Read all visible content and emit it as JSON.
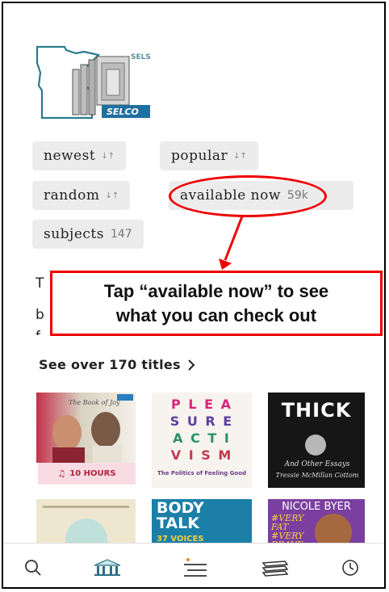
{
  "logo": {
    "top_text": "SELS",
    "bottom_text": "SELCO"
  },
  "filters": [
    {
      "label": "newest",
      "sort": "↓↑",
      "count": ""
    },
    {
      "label": "popular",
      "sort": "↓↑",
      "count": ""
    },
    {
      "label": "random",
      "sort": "↓↑",
      "count": ""
    },
    {
      "label": "available now",
      "sort": "",
      "count": "59k"
    },
    {
      "label": "subjects",
      "sort": "",
      "count": "147"
    }
  ],
  "callout": {
    "line1": "Tap “available now” to see",
    "line2": "what you can check out"
  },
  "partial_text": {
    "t": "T",
    "b": "b",
    "f": "f"
  },
  "see_more": "See over 170 titles",
  "books": [
    {
      "title": "The Book of Joy",
      "badge": "10 HOURS"
    },
    {
      "title_lines": [
        "P L E A",
        "S U R E",
        "A C T I",
        "V I S M"
      ],
      "subtitle": "The Politics of Feeling Good"
    },
    {
      "title": "THICK",
      "subtitle": "And Other Essays",
      "author": "Tressie McMillan Cottom"
    },
    {
      "title": ""
    },
    {
      "title_lines": [
        "BODY",
        "TALK"
      ],
      "subtitle": "37 VOICES"
    },
    {
      "author": "NICOLE BYER",
      "title_lines": [
        "#VERY",
        "FAT",
        "#VERY",
        "BRAVE"
      ]
    }
  ],
  "colors": {
    "accent": "#e00000",
    "chip_bg": "#ececec",
    "badge_bg": "#f9dce3"
  },
  "nav": [
    "search-icon",
    "library-icon",
    "menu-icon",
    "shelf-icon",
    "clock-icon"
  ]
}
